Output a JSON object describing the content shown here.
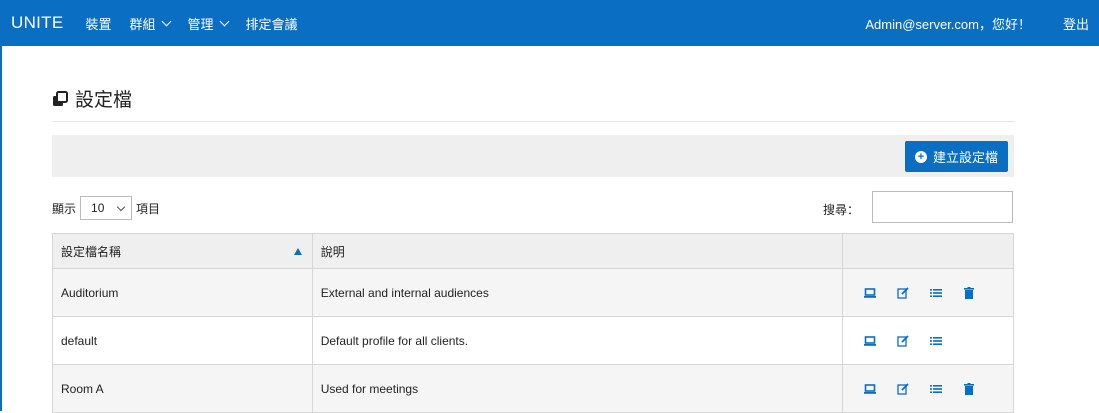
{
  "topbar": {
    "brand": "UNITE",
    "nav": [
      {
        "label": "裝置",
        "has_dropdown": false
      },
      {
        "label": "群組",
        "has_dropdown": true
      },
      {
        "label": "管理",
        "has_dropdown": true
      },
      {
        "label": "排定會議",
        "has_dropdown": false
      }
    ],
    "greeting": "Admin@server.com，您好！",
    "logout": "登出"
  },
  "page": {
    "title": "設定檔",
    "create_button": "建立設定檔"
  },
  "list_controls": {
    "show_label": "顯示",
    "page_length": "10",
    "items_label": "項目",
    "search_label": "搜尋：",
    "search_value": ""
  },
  "table": {
    "columns": [
      "設定檔名稱",
      "說明",
      ""
    ],
    "sort": {
      "column": "設定檔名稱",
      "direction": "asc"
    },
    "rows": [
      {
        "name": "Auditorium",
        "description": "External and internal audiences",
        "actions": [
          "monitor-icon",
          "edit-icon",
          "list-icon",
          "trash-icon"
        ]
      },
      {
        "name": "default",
        "description": "Default profile for all clients.",
        "actions": [
          "monitor-icon",
          "edit-icon",
          "list-icon"
        ]
      },
      {
        "name": "Room A",
        "description": "Used for meetings",
        "actions": [
          "monitor-icon",
          "edit-icon",
          "list-icon",
          "trash-icon"
        ]
      }
    ]
  },
  "colors": {
    "accent": "#0a6ec3",
    "toolbar_bg": "#efefef",
    "header_bg": "#efefef"
  }
}
